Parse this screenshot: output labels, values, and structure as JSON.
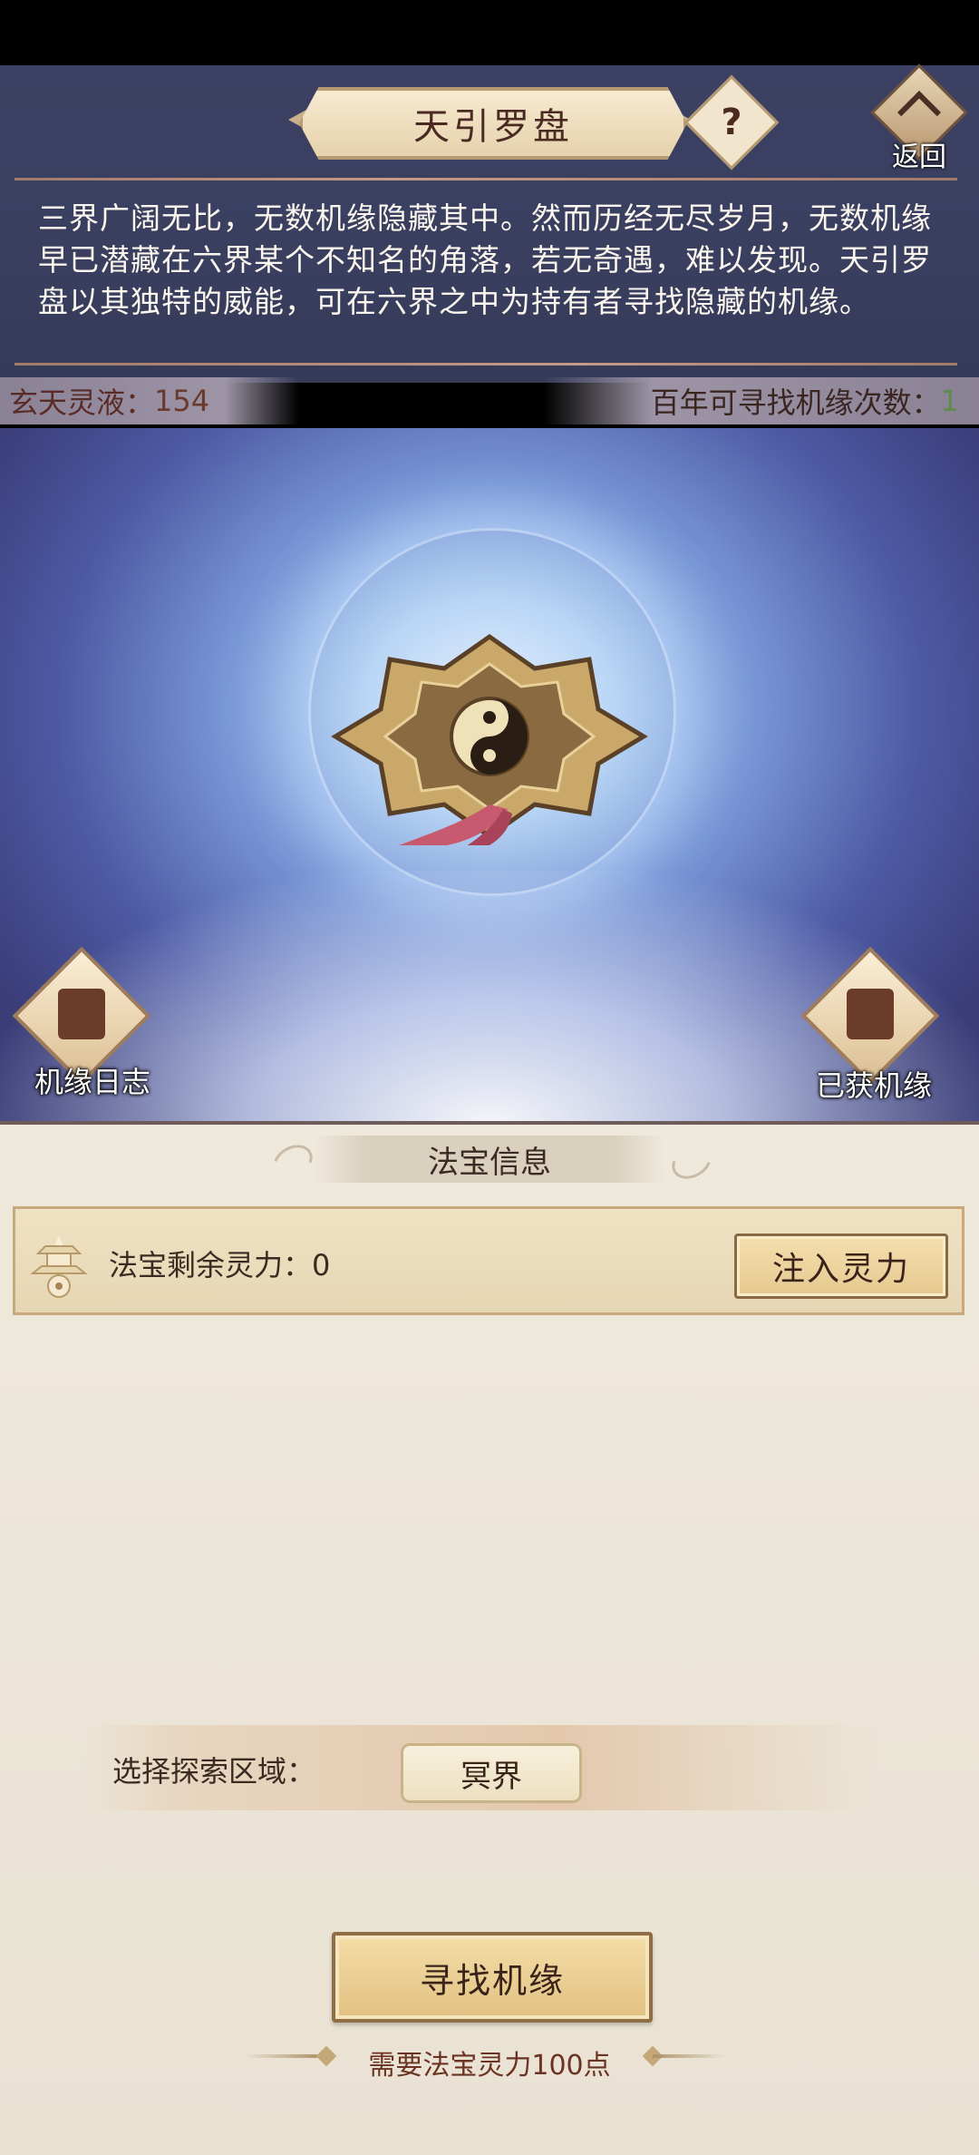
{
  "header": {
    "title": "天引罗盘",
    "help_label": "?",
    "back_label": "返回"
  },
  "description": "三界广阔无比，无数机缘隐藏其中。然而历经无尽岁月，无数机缘早已潜藏在六界某个不知名的角落，若无奇遇，难以发现。天引罗盘以其独特的威能，可在六界之中为持有者寻找隐藏的机缘。",
  "stats": {
    "left_label": "玄天灵液：",
    "left_value": "154",
    "right_label": "百年可寻找机缘次数：",
    "right_value": "1"
  },
  "scene": {
    "log_label": "机缘日志",
    "obtained_label": "已获机缘"
  },
  "treasure": {
    "section_title": "法宝信息",
    "remaining_label": "法宝剩余灵力：",
    "remaining_value": "0",
    "inject_label": "注入灵力"
  },
  "region": {
    "label": "选择探索区域：",
    "selected": "冥界"
  },
  "action": {
    "find_label": "寻找机缘",
    "cost_note": "需要法宝灵力100点"
  },
  "colors": {
    "top_panel": "#3c4163",
    "bottom_panel": "#efe9dc",
    "button_gold": "#e5c88f",
    "accent_brown": "#6b3322",
    "count_green": "#5e8c4a"
  },
  "icons": {
    "help": "question-icon",
    "back": "back-arrow-icon",
    "log": "scroll-icon",
    "obtained": "book-icon",
    "treasure": "pagoda-icon",
    "compass": "compass-icon"
  }
}
